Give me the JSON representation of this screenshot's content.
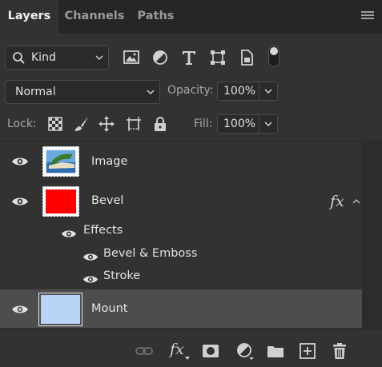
{
  "tabs": [
    {
      "label": "Layers",
      "active": true
    },
    {
      "label": "Channels",
      "active": false
    },
    {
      "label": "Paths",
      "active": false
    }
  ],
  "filter": {
    "kind_label": "Kind",
    "icons": [
      "image-filter-icon",
      "adjustment-filter-icon",
      "type-filter-icon",
      "shape-filter-icon",
      "smart-object-filter-icon",
      "filter-toggle-switch"
    ]
  },
  "blend": {
    "mode": "Normal",
    "opacity_label": "Opacity:",
    "opacity_value": "100%"
  },
  "lock": {
    "label": "Lock:",
    "icons": [
      "lock-transparent-icon",
      "lock-pixels-icon",
      "lock-position-icon",
      "lock-artboard-icon",
      "lock-all-icon"
    ],
    "fill_label": "Fill:",
    "fill_value": "100%"
  },
  "layers": [
    {
      "name": "Image",
      "visible": true,
      "selected": false,
      "has_fx": false
    },
    {
      "name": "Bevel",
      "visible": true,
      "selected": false,
      "has_fx": true,
      "fx_label": "fx"
    },
    {
      "name": "Mount",
      "visible": true,
      "selected": true,
      "has_fx": false
    }
  ],
  "effects": {
    "label": "Effects",
    "items": [
      {
        "name": "Bevel & Emboss"
      },
      {
        "name": "Stroke"
      }
    ]
  },
  "bottom_bar": {
    "fx_label": "fx",
    "icons": [
      "link-layers-icon",
      "fx-icon",
      "add-mask-icon",
      "adjustment-layer-icon",
      "new-group-icon",
      "new-layer-icon",
      "delete-layer-icon"
    ]
  },
  "colors": {
    "panel_bg": "#323232",
    "tab_bar_bg": "#262626",
    "selected_row": "#4d4d4d",
    "bevel_thumb": "#ff0000",
    "mount_thumb": "#b7d3f5"
  }
}
